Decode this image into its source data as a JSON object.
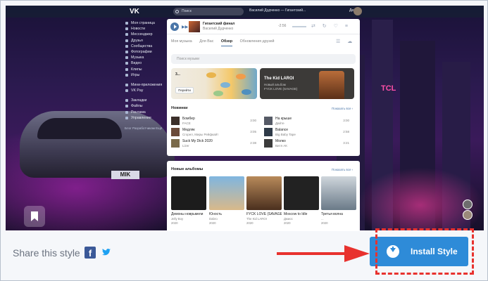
{
  "topbar": {
    "logo": "VK",
    "search_placeholder": "Поиск",
    "now_playing": "Василий Дудченко — Гигантский...",
    "user_name": "Денис"
  },
  "menu": {
    "items": [
      "Моя страница",
      "Новости",
      "Мессенджер",
      "Друзья",
      "Сообщества",
      "Фотографии",
      "Музыка",
      "Видео",
      "Клипы",
      "Игры"
    ],
    "items2": [
      "Мини-приложения",
      "VK Pay"
    ],
    "items3": [
      "Закладки",
      "Файлы",
      "Реклама",
      "Управление"
    ],
    "footer": "Блог Разработчикам Ещё"
  },
  "player": {
    "track_title": "Гигантский финал",
    "track_artist": "Василий Дудченко",
    "time": "-2:56"
  },
  "music": {
    "tabs": [
      "Моя музыка",
      "Для Вас",
      "Обзор",
      "Обновления друзей"
    ],
    "active_tab": "Обзор",
    "search_placeholder": "Поиск музыки",
    "banner1_text": "3...",
    "banner1_button": "Перейти",
    "banner2_title": "The Kid LAROI",
    "banner2_sub1": "Новый альбом",
    "banner2_sub2": "FYCK LOVE (SAVAGE)",
    "new_tracks_title": "Новинки",
    "show_all": "Показать все ›",
    "tracks": [
      {
        "title": "Бомбер",
        "artist": "FACE",
        "duration": "3:00"
      },
      {
        "title": "На крыше",
        "artist": "Дайте",
        "duration": "3:00"
      },
      {
        "title": "Медляк",
        "artist": "Сгорел, Миры Рейфкайт",
        "duration": "3:05"
      },
      {
        "title": "Balance",
        "artist": "Big Baby Tape",
        "duration": "2:58"
      },
      {
        "title": "Suck My Dick 2020",
        "artist": "Lizer",
        "duration": "2:38"
      },
      {
        "title": "Молко",
        "artist": "Витя АК",
        "duration": "3:21"
      }
    ],
    "albums_title": "Новые альбомы",
    "albums": [
      {
        "name": "Демоны новрьмели",
        "artist": "Jelly Boy",
        "year": "2020"
      },
      {
        "name": "Юность",
        "artist": "Dabro",
        "year": "2020"
      },
      {
        "name": "FYCK LOVE (SAVAGE)",
        "artist": "The Kid LAROI",
        "year": "2020"
      },
      {
        "name": "Moscow to Idle",
        "artist": "Джиос",
        "year": "2020"
      },
      {
        "name": "Третья волна",
        "artist": "...",
        "year": "2020"
      }
    ]
  },
  "wallpaper": {
    "plate": "MIK",
    "sign": "TCL"
  },
  "bottom": {
    "share_text": "Share this style",
    "facebook_glyph": "f",
    "install_label": "Install Style"
  },
  "colors": {
    "vk_blue": "#4a76a8",
    "install_blue": "#2e8bd8",
    "highlight_red": "#e8322e"
  }
}
